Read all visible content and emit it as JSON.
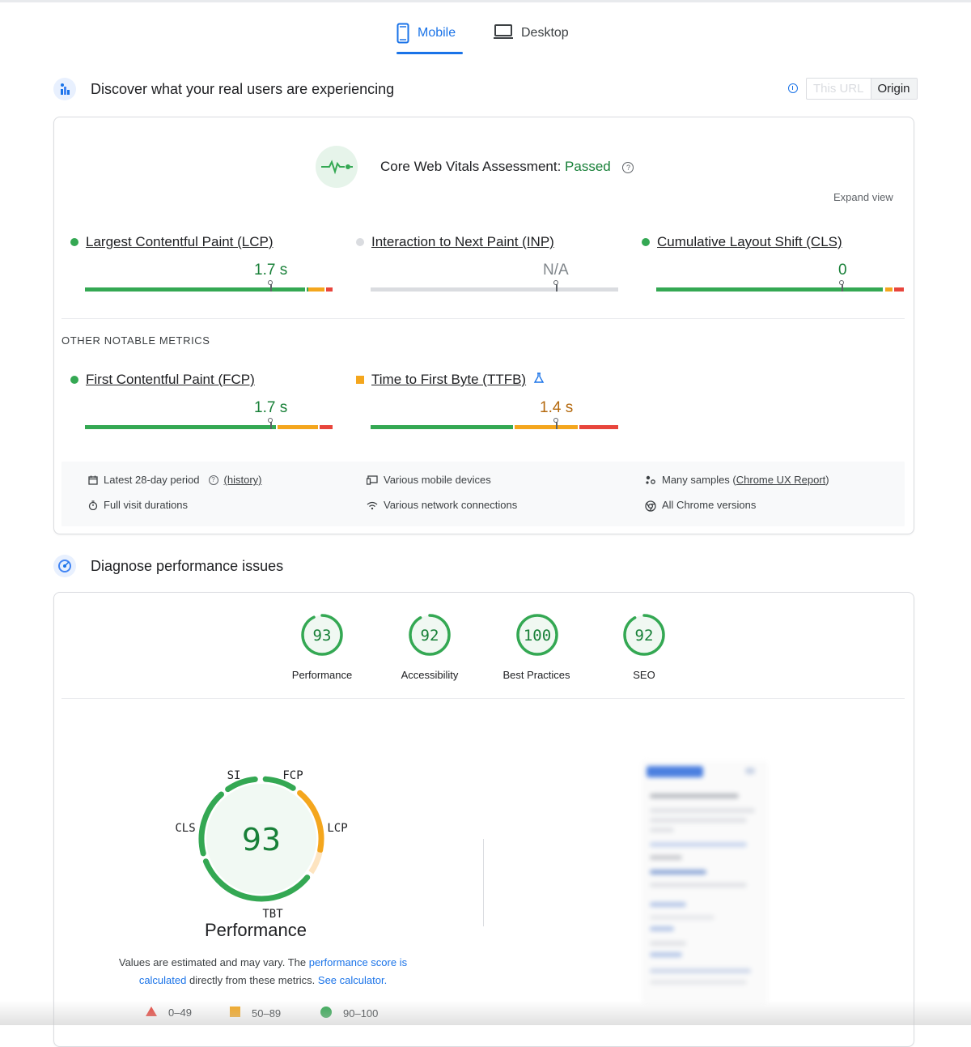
{
  "tabs": [
    {
      "label": "Mobile",
      "icon": "smartphone-icon",
      "active": true
    },
    {
      "label": "Desktop",
      "icon": "laptop-icon",
      "active": false
    }
  ],
  "field_section": {
    "title": "Discover what your real users are experiencing",
    "toggle": {
      "url_label": "This URL",
      "origin_label": "Origin",
      "selected": "Origin"
    },
    "assessment_label": "Core Web Vitals Assessment:",
    "assessment_result": "Passed",
    "expand_label": "Expand view",
    "core_metrics": [
      {
        "name": "Largest Contentful Paint (LCP)",
        "value": "1.7 s",
        "status": "good"
      },
      {
        "name": "Interaction to Next Paint (INP)",
        "value": "N/A",
        "status": "none"
      },
      {
        "name": "Cumulative Layout Shift (CLS)",
        "value": "0",
        "status": "good"
      }
    ],
    "other_title": "OTHER NOTABLE METRICS",
    "other_metrics": [
      {
        "name": "First Contentful Paint (FCP)",
        "value": "1.7 s",
        "status": "good"
      },
      {
        "name": "Time to First Byte (TTFB)",
        "value": "1.4 s",
        "status": "average"
      }
    ],
    "info": {
      "period": "Latest 28-day period",
      "history": "(history)",
      "devices": "Various mobile devices",
      "samples_prefix": "Many samples (",
      "samples_link": "Chrome UX Report",
      "samples_suffix": ")",
      "durations": "Full visit durations",
      "network": "Various network connections",
      "versions": "All Chrome versions"
    }
  },
  "diagnose_section": {
    "title": "Diagnose performance issues",
    "scores": [
      {
        "label": "Performance",
        "score": "93"
      },
      {
        "label": "Accessibility",
        "score": "92"
      },
      {
        "label": "Best Practices",
        "score": "100"
      },
      {
        "label": "SEO",
        "score": "92"
      }
    ],
    "big_gauge": {
      "score": "93",
      "title": "Performance",
      "metric_labels": {
        "si": "SI",
        "fcp": "FCP",
        "lcp": "LCP",
        "tbt": "TBT",
        "cls": "CLS"
      }
    },
    "note_prefix": "Values are estimated and may vary. The ",
    "note_link1": "performance score is calculated",
    "note_middle": " directly from these metrics. ",
    "note_link2": "See calculator.",
    "legend": [
      {
        "label": "0–49",
        "shape": "triangle",
        "color": "#e8453c"
      },
      {
        "label": "50–89",
        "shape": "square",
        "color": "#f4a61d"
      },
      {
        "label": "90–100",
        "shape": "circle",
        "color": "#34a853"
      }
    ]
  },
  "colors": {
    "accent": "#1a73e8",
    "good": "#34a853",
    "average": "#f4a61d",
    "poor": "#e8453c"
  }
}
